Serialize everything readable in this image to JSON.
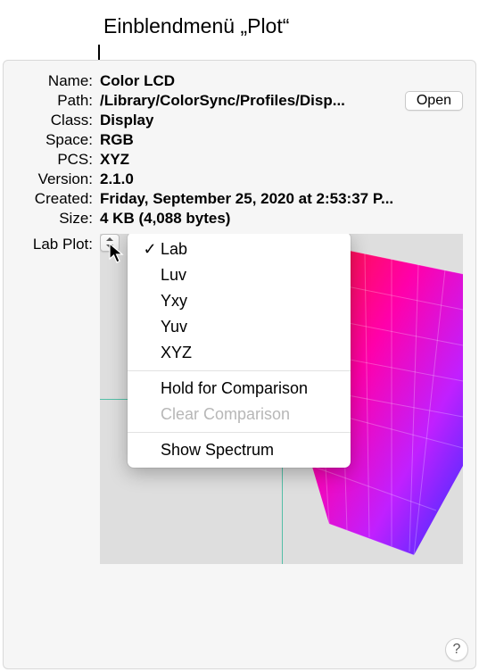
{
  "caption": "Einblendmenü „Plot“",
  "fields": {
    "name_label": "Name:",
    "name_value": "Color LCD",
    "path_label": "Path:",
    "path_value": "/Library/ColorSync/Profiles/Disp...",
    "class_label": "Class:",
    "class_value": "Display",
    "space_label": "Space:",
    "space_value": "RGB",
    "pcs_label": "PCS:",
    "pcs_value": "XYZ",
    "version_label": "Version:",
    "version_value": "2.1.0",
    "created_label": "Created:",
    "created_value": "Friday, September 25, 2020 at 2:53:37 P...",
    "size_label": "Size:",
    "size_value": "4 KB (4,088 bytes)"
  },
  "open_button": "Open",
  "lab_plot_label": "Lab Plot:",
  "menu": {
    "items": [
      {
        "label": "Lab",
        "checked": true,
        "enabled": true
      },
      {
        "label": "Luv",
        "checked": false,
        "enabled": true
      },
      {
        "label": "Yxy",
        "checked": false,
        "enabled": true
      },
      {
        "label": "Yuv",
        "checked": false,
        "enabled": true
      },
      {
        "label": "XYZ",
        "checked": false,
        "enabled": true
      }
    ],
    "hold": "Hold for Comparison",
    "clear": "Clear Comparison",
    "spectrum": "Show Spectrum"
  },
  "help": "?",
  "checkmark": "✓"
}
